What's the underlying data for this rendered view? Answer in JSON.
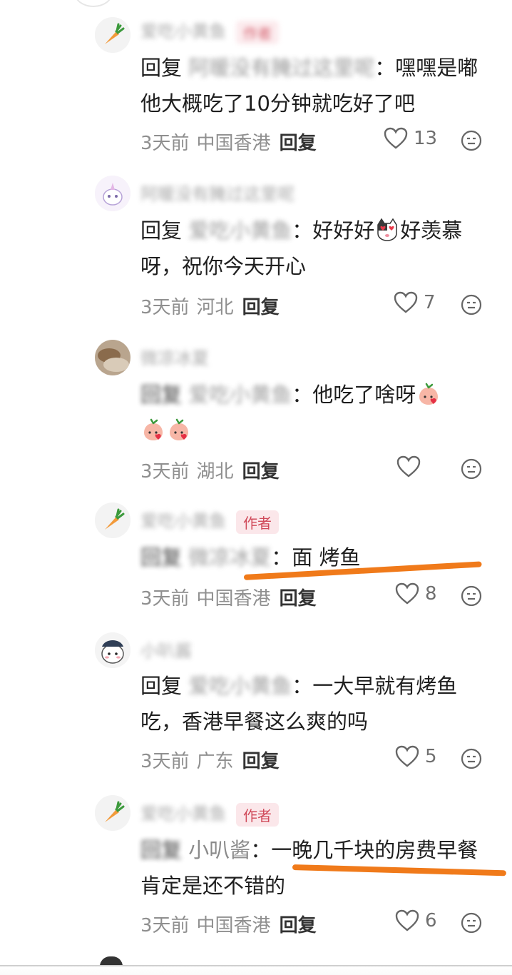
{
  "labels": {
    "reply_word": "回复",
    "author_badge": "作者",
    "colon": "："
  },
  "comments": [
    {
      "username": "爱吃小黄鱼",
      "is_author": true,
      "reply_target": "阿暖没有腌过这里呢",
      "text": "嘿嘿是嘟 他大概吃了10分钟就吃好了吧",
      "time": "3天前",
      "location": "中国香港",
      "likes": "13",
      "avatar": "carrot-avatar"
    },
    {
      "username": "阿暖没有腌过这里呢",
      "is_author": false,
      "reply_target": "爱吃小黄鱼",
      "text_a": "好好好",
      "text_b": "好羡慕呀，祝你今天开心",
      "time": "3天前",
      "location": "河北",
      "likes": "7",
      "avatar": "unicorn-avatar"
    },
    {
      "username": "微凉冰夏",
      "is_author": false,
      "reply_target": "爱吃小黄鱼",
      "text": "他吃了啥呀",
      "time": "3天前",
      "location": "湖北",
      "likes": "",
      "avatar": "photo-avatar"
    },
    {
      "username": "爱吃小黄鱼",
      "is_author": true,
      "reply_target": "微凉冰夏",
      "text": "面 烤鱼",
      "time": "3天前",
      "location": "中国香港",
      "likes": "8",
      "avatar": "carrot-avatar"
    },
    {
      "username": "小叭酱",
      "is_author": false,
      "reply_target": "爱吃小黄鱼",
      "text": "一大早就有烤鱼吃，香港早餐这么爽的吗",
      "time": "3天前",
      "location": "广东",
      "likes": "5",
      "avatar": "cartoon-avatar"
    },
    {
      "username": "爱吃小黄鱼",
      "is_author": true,
      "reply_target": "小叭酱",
      "text": "一晚几千块的房费早餐肯定是还不错的",
      "time": "3天前",
      "location": "中国香港",
      "likes": "6",
      "avatar": "carrot-avatar"
    }
  ],
  "colors": {
    "annotation_underline": "#f07a1a",
    "author_badge": "#d04a5a"
  }
}
